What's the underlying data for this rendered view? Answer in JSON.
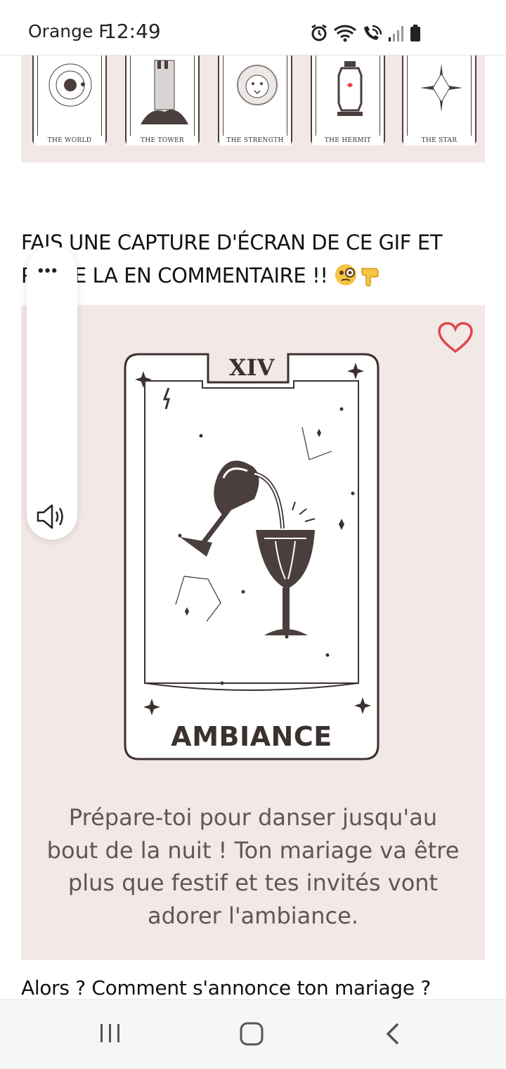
{
  "status_bar": {
    "carrier": "Orange F",
    "time": "12:49",
    "icons": [
      "alarm-icon",
      "wifi-icon",
      "wifi-calling-icon",
      "signal-icon",
      "battery-icon"
    ]
  },
  "top_strip": {
    "cards": [
      {
        "label": "THE WORLD",
        "icon": "world-icon"
      },
      {
        "label": "THE TOWER",
        "icon": "tower-icon"
      },
      {
        "label": "THE STRENGTH",
        "icon": "lion-icon"
      },
      {
        "label": "THE HERMIT",
        "icon": "lantern-icon"
      },
      {
        "label": "THE STAR",
        "icon": "star-icon"
      }
    ]
  },
  "post": {
    "headline_line1": "FAIS UNE CAPTURE D'ÉCRAN DE CE GIF ET",
    "headline_line2": "POSTE LA EN COMMENTAIRE !!",
    "headline_emojis": [
      "monocle-face-emoji",
      "pointing-down-emoji"
    ],
    "question": "Alors ? Comment s'annonce ton mariage ?"
  },
  "overlay": {
    "more_label": "•••",
    "icons": [
      "more-icon",
      "speaker-icon"
    ]
  },
  "gif": {
    "card_number": "XIV",
    "card_title": "AMBIANCE",
    "caption_line1": "Prépare-toi pour danser jusqu'au",
    "caption_line2": "bout de la nuit ! Ton mariage va être",
    "caption_line3": "plus que festif et tes invités vont",
    "caption_line4": "adorer l'ambiance.",
    "colors": {
      "background": "#f2e8e5",
      "ink": "#3b3230",
      "heart": "#e0474c",
      "caption": "#5e5756"
    }
  },
  "nav_bar": {
    "buttons": [
      "recents-icon",
      "home-icon",
      "back-icon"
    ]
  }
}
